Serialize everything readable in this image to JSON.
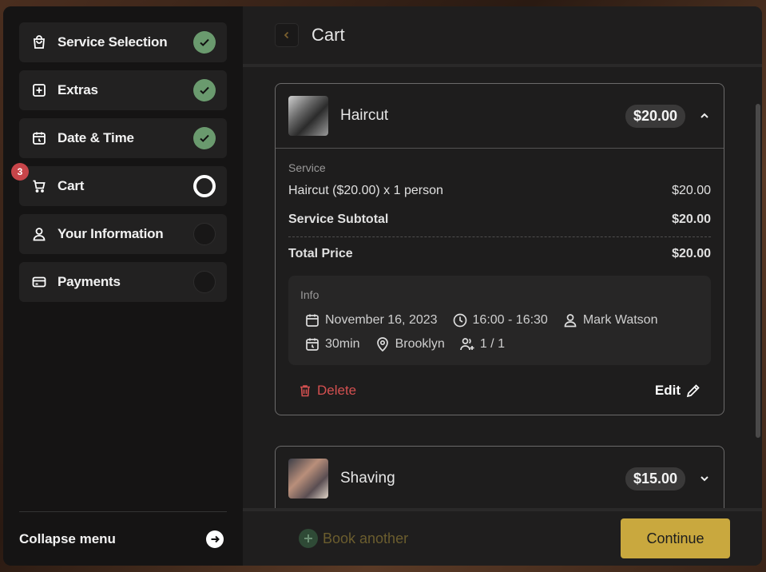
{
  "sidebar": {
    "items": [
      {
        "label": "Service Selection",
        "icon": "bag-icon",
        "status": "done"
      },
      {
        "label": "Extras",
        "icon": "plus-square-icon",
        "status": "done"
      },
      {
        "label": "Date & Time",
        "icon": "calendar-clock-icon",
        "status": "done"
      },
      {
        "label": "Cart",
        "icon": "cart-icon",
        "status": "current",
        "badge": "3"
      },
      {
        "label": "Your Information",
        "icon": "user-icon",
        "status": "pending"
      },
      {
        "label": "Payments",
        "icon": "card-icon",
        "status": "pending"
      }
    ],
    "collapse_label": "Collapse menu"
  },
  "header": {
    "title": "Cart"
  },
  "cart": {
    "items": [
      {
        "name": "Haircut",
        "price": "$20.00",
        "expanded": true,
        "section_label": "Service",
        "line_label": "Haircut ($20.00) x 1 person",
        "line_value": "$20.00",
        "subtotal_label": "Service Subtotal",
        "subtotal_value": "$20.00",
        "total_label": "Total Price",
        "total_value": "$20.00",
        "info": {
          "title": "Info",
          "date": "November 16, 2023",
          "time": "16:00 - 16:30",
          "employee": "Mark Watson",
          "duration": "30min",
          "location": "Brooklyn",
          "capacity": "1 / 1"
        },
        "delete_label": "Delete",
        "edit_label": "Edit"
      },
      {
        "name": "Shaving",
        "price": "$15.00",
        "expanded": false
      }
    ]
  },
  "footer": {
    "book_another_label": "Book another",
    "continue_label": "Continue"
  },
  "colors": {
    "accent": "#c9a83e",
    "done": "#6a9a6e",
    "danger": "#d45050",
    "badge": "#c8454a"
  }
}
